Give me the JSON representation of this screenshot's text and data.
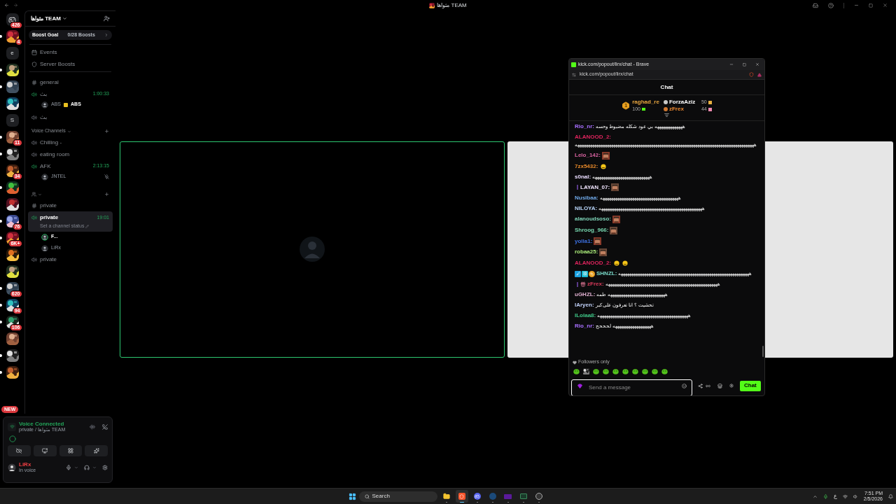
{
  "window": {
    "title": "مثواها TEAM"
  },
  "servers": [
    {
      "kind": "dm",
      "badge": "426",
      "unread": false
    },
    {
      "kind": "picture",
      "badge": "4",
      "unread": true
    },
    {
      "kind": "letter",
      "label": "e",
      "unread": false
    },
    {
      "kind": "picture",
      "unread": true
    },
    {
      "kind": "picture",
      "unread": true
    },
    {
      "kind": "picture",
      "unread": false
    },
    {
      "kind": "letter",
      "label": "S",
      "unread": false
    },
    {
      "kind": "picture",
      "badge": "11",
      "unread": true
    },
    {
      "kind": "picture",
      "unread": true
    },
    {
      "kind": "picture",
      "badge": "34",
      "unread": false
    },
    {
      "kind": "picture",
      "unread": true
    },
    {
      "kind": "picture",
      "unread": false
    },
    {
      "kind": "picture",
      "badge": "76",
      "unread": true
    },
    {
      "kind": "picture",
      "badge": "6K+",
      "unread": true
    },
    {
      "kind": "picture",
      "unread": false
    },
    {
      "kind": "picture",
      "unread": false
    },
    {
      "kind": "picture",
      "badge": "620",
      "unread": true
    },
    {
      "kind": "picture",
      "badge": "94",
      "unread": true
    },
    {
      "kind": "picture",
      "badge": "106",
      "unread": true
    },
    {
      "kind": "picture",
      "unread": false
    },
    {
      "kind": "picture",
      "unread": true
    },
    {
      "kind": "picture",
      "unread": true
    }
  ],
  "rail_pill": "NEW",
  "server": {
    "name": "مثواها TEAM",
    "boost_label": "Boost Goal",
    "boost_progress": "0/28 Boosts"
  },
  "menu": [
    {
      "kind": "events",
      "label": "Events"
    },
    {
      "kind": "boosts",
      "label": "Server Boosts"
    }
  ],
  "channels": [
    {
      "kind": "text",
      "name": "general",
      "selected": false
    },
    {
      "kind": "voice",
      "name": "بث",
      "active": true,
      "selected": false,
      "time": "1:00:33",
      "users": [
        {
          "name": "ABS",
          "tag": "ABS",
          "speaking": false,
          "muted": false
        }
      ]
    },
    {
      "kind": "voice",
      "name": "بث",
      "active": false,
      "selected": false
    },
    {
      "kind": "category",
      "name": "Voice Channels"
    },
    {
      "kind": "voice",
      "name": "Chilling -",
      "active": false,
      "selected": false
    },
    {
      "kind": "voice",
      "name": "eating room",
      "active": false,
      "selected": false
    },
    {
      "kind": "voice",
      "name": "AFK",
      "active": true,
      "selected": false,
      "time": "2:13:15",
      "users": [
        {
          "name": "JNTEL",
          "speaking": false,
          "muted": true
        }
      ]
    },
    {
      "kind": "category_icon"
    },
    {
      "kind": "text",
      "name": "private",
      "selected": false
    },
    {
      "kind": "voice",
      "name": "private",
      "active": true,
      "selected": true,
      "time": "19:01",
      "status": "Set a channel status",
      "users": [
        {
          "name": "F...",
          "speaking": true,
          "muted": false
        },
        {
          "name": "LiRx",
          "speaking": false,
          "muted": false
        }
      ]
    },
    {
      "kind": "voice",
      "name": "private",
      "active": false,
      "selected": false
    }
  ],
  "voice_panel": {
    "title": "Voice Connected",
    "location": "private / مثواها TEAM"
  },
  "user": {
    "name": "LiRx",
    "status": "In voice"
  },
  "popup": {
    "title": "kick.com/popout/lirx/chat - Brave",
    "url": "kick.com/popout/lirx/chat",
    "header": "Chat",
    "leaders": [
      {
        "rank": "1",
        "name": "raghad_re",
        "points": "100",
        "color": "#e8a640"
      },
      {
        "name": "ForzaAziz",
        "points": "50",
        "color": "#ffffff"
      },
      {
        "name": "zFrex",
        "points": "44",
        "color": "#f08a30"
      }
    ],
    "messages": [
      {
        "user": "Rio_nr:",
        "color": "#a970ff",
        "parts": [
          {
            "kind": "text",
            "text": "هههههههههههههه بي عود شكله مضبوط وحسه"
          }
        ]
      },
      {
        "user": "ALANOOD_2:",
        "color": "#e0245e",
        "parts": [
          {
            "kind": "text",
            "text": "هههههههههههههههههههههههههههههههههههههههههههههههههههههههههههههههههههههههههههههههههههههه"
          }
        ]
      },
      {
        "user": "Lelo_142:",
        "color": "#d863a0",
        "parts": [
          {
            "kind": "emote"
          }
        ]
      },
      {
        "user": "7zx5432:",
        "color": "#e88a2a",
        "parts": [
          {
            "kind": "emoji"
          }
        ]
      },
      {
        "user": "s0nal:",
        "color": "#eadcff",
        "parts": [
          {
            "kind": "text",
            "text": "هههههههههههههههههههههههههههه"
          }
        ]
      },
      {
        "user": "LAYAN_07:",
        "color": "#f2e6ff",
        "badges": [
          {
            "kind": "sub"
          }
        ],
        "parts": [
          {
            "kind": "emote"
          }
        ]
      },
      {
        "user": "Nusibaa:",
        "color": "#6fa8e8",
        "parts": [
          {
            "kind": "text",
            "text": "هههههههههههههههههههههههههههههههههههههه"
          }
        ]
      },
      {
        "user": "NILOYA:",
        "color": "#b8d4f8",
        "parts": [
          {
            "kind": "text",
            "text": "هههههههههههههههههههههههههههههههههههههههههههههههههه"
          }
        ]
      },
      {
        "user": "alanoudsoso:",
        "color": "#7ed4b8",
        "parts": [
          {
            "kind": "emote"
          }
        ]
      },
      {
        "user": "Shroog_966:",
        "color": "#78d8b0",
        "parts": [
          {
            "kind": "emote"
          }
        ]
      },
      {
        "user": "yolla1:",
        "color": "#3c6fe0",
        "parts": [
          {
            "kind": "emote"
          }
        ]
      },
      {
        "user": "robaa25:",
        "color": "#a8e878",
        "parts": [
          {
            "kind": "emote"
          }
        ]
      },
      {
        "user": "ALANOOD_2:",
        "color": "#e0245e",
        "parts": [
          {
            "kind": "emoji"
          },
          {
            "kind": "emoji"
          }
        ]
      },
      {
        "user": "SHNZL:",
        "color": "#78d8c8",
        "badges": [
          {
            "kind": "mod"
          },
          {
            "kind": "vip"
          },
          {
            "kind": "coin"
          }
        ],
        "parts": [
          {
            "kind": "text",
            "text": "ههههههههههههههههههههههههههههههههههههههههههههههههههههههههههههههه"
          }
        ]
      },
      {
        "user": "zFrex:",
        "color": "#d83a5a",
        "badges": [
          {
            "kind": "sub"
          },
          {
            "kind": "gift"
          }
        ],
        "parts": [
          {
            "kind": "text",
            "text": "هههههههههههههههههههههههههههههههههههههههههههههههههههههه"
          }
        ]
      },
      {
        "user": "uGHZL:",
        "color": "#e0b0d0",
        "parts": [
          {
            "kind": "text",
            "text": "هههههههههههههههههههههههههههه طمه"
          }
        ]
      },
      {
        "user": "lAryen:",
        "color": "#c0d0f8",
        "parts": [
          {
            "kind": "text",
            "text": "تحشيت ؟ انا تعرفون على كبر"
          }
        ]
      },
      {
        "user": "lLolaa8:",
        "color": "#40c888",
        "parts": [
          {
            "kind": "text",
            "text": "هههههههههههههههههههههههههههههههههههههههههههه"
          }
        ]
      },
      {
        "user": "Rio_nr:",
        "color": "#a970ff",
        "parts": [
          {
            "kind": "text",
            "text": "ههههههههههههههههههه لحححح"
          }
        ]
      }
    ],
    "mode": "Followers only",
    "placeholder": "Send a message",
    "send": "Chat"
  },
  "taskbar": {
    "search": "Search",
    "language": "ع",
    "time": "7:51 PM",
    "date": "2/5/2026",
    "apps": [
      {
        "kind": "files",
        "selected": false
      },
      {
        "kind": "brave",
        "selected": true
      },
      {
        "kind": "discord",
        "selected": false
      },
      {
        "kind": "steam",
        "selected": false
      },
      {
        "kind": "purple",
        "selected": false
      },
      {
        "kind": "sheet",
        "selected": false
      },
      {
        "kind": "obs",
        "selected": false
      }
    ]
  }
}
